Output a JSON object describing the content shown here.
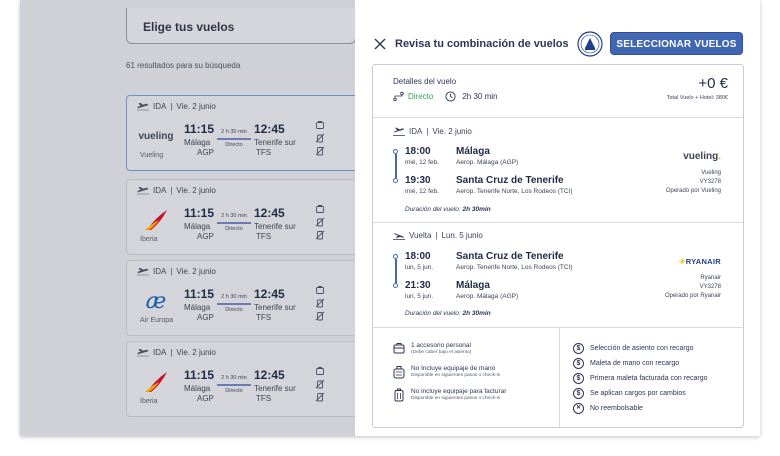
{
  "background": {
    "header_title": "Elige tus vuelos",
    "results_count": "61 resultados para su búsqueda",
    "cards": [
      {
        "direction": "IDA",
        "date": "Vie. 2 junio",
        "airline": "Vueling",
        "dep_time": "11:15",
        "arr_time": "12:45",
        "duration": "2 h 30 min",
        "type": "Directo",
        "from_city": "Málaga",
        "from_code": "AGP",
        "to_city": "Tenerife sur",
        "to_code": "TFS"
      },
      {
        "direction": "IDA",
        "date": "Vie. 2 junio",
        "airline": "Iberia",
        "dep_time": "11:15",
        "arr_time": "12:45",
        "duration": "2 h 30 min",
        "type": "Directo",
        "from_city": "Málaga",
        "from_code": "AGP",
        "to_city": "Tenerife sur",
        "to_code": "TFS"
      },
      {
        "direction": "IDA",
        "date": "Vie. 2 junio",
        "airline": "Air Europa",
        "dep_time": "11:15",
        "arr_time": "12:45",
        "duration": "2 h 30 min",
        "type": "Directo",
        "from_city": "Málaga",
        "from_code": "AGP",
        "to_city": "Tenerife sur",
        "to_code": "TFS"
      },
      {
        "direction": "IDA",
        "date": "Vie. 2 junio",
        "airline": "Iberia",
        "dep_time": "11:15",
        "arr_time": "12:45",
        "duration": "2 h 30 min",
        "type": "Directo",
        "from_city": "Málaga",
        "from_code": "AGP",
        "to_city": "Tenerife sur",
        "to_code": "TFS"
      }
    ]
  },
  "panel": {
    "title": "Revisa tu combinación de vuelos",
    "select_button": "SELECCIONAR VUELOS",
    "details_title": "Detalles del vuelo",
    "direct_label": "Directo",
    "duration": "2h 30 min",
    "price": "+0 €",
    "price_note": "Total Vuelo + Hotel: 380€"
  },
  "outbound": {
    "direction": "IDA",
    "date": "Vie. 2 junio",
    "dep_time": "18:00",
    "dep_date": "mié, 12 feb.",
    "dep_city": "Málaga",
    "dep_airport": "Aerop. Málaga (AGP)",
    "arr_time": "19:30",
    "arr_date": "mié, 12 feb.",
    "arr_city": "Santa Cruz de Tenerife",
    "arr_airport": "Aerop. Tenerife Norte, Los Rodeos (TCI)",
    "duration_label": "Duración del vuelo:",
    "duration_value": "2h 30min",
    "airline_logo": "vueling",
    "airline": "Vueling",
    "flight_no": "VY3278",
    "operated": "Operado por Vueling"
  },
  "return": {
    "direction": "Vuelta",
    "date": "Lun. 5 junio",
    "dep_time": "18:00",
    "dep_date": "lun, 5 jun.",
    "dep_city": "Santa Cruz de Tenerife",
    "dep_airport": "Aerop. Tenerife Norte, Los Rodeos (TCI)",
    "arr_time": "21:30",
    "arr_date": "lun, 5 jun.",
    "arr_city": "Málaga",
    "arr_airport": "Aerop. Málaga (AGP)",
    "duration_label": "Duración del vuelo:",
    "duration_value": "2h 30min",
    "airline_logo": "RYANAIR",
    "airline": "Ryanair",
    "flight_no": "VY3278",
    "operated": "Operado por Ryanair"
  },
  "baggage": [
    {
      "icon": "backpack-icon",
      "title": "1 accesorio personal",
      "note": "(Debe caber bajo el asiento)"
    },
    {
      "icon": "cabin-bag-icon",
      "title": "No Incluye equipaje de mano",
      "note": "Disponible en siguientes pasos o check-in"
    },
    {
      "icon": "checked-bag-icon",
      "title": "No incluye equipaje para facturar",
      "note": "Disponible en siguientes pasos o check-in"
    }
  ],
  "conditions": [
    {
      "symbol": "$",
      "label": "Selección de asiento con recargo"
    },
    {
      "symbol": "$",
      "label": "Maleta de mano con recargo"
    },
    {
      "symbol": "$",
      "label": "Primera maleta facturada con recargo"
    },
    {
      "symbol": "$",
      "label": "Se aplican cargos por cambios"
    },
    {
      "symbol": "✕",
      "label": "No reembolsable"
    }
  ]
}
